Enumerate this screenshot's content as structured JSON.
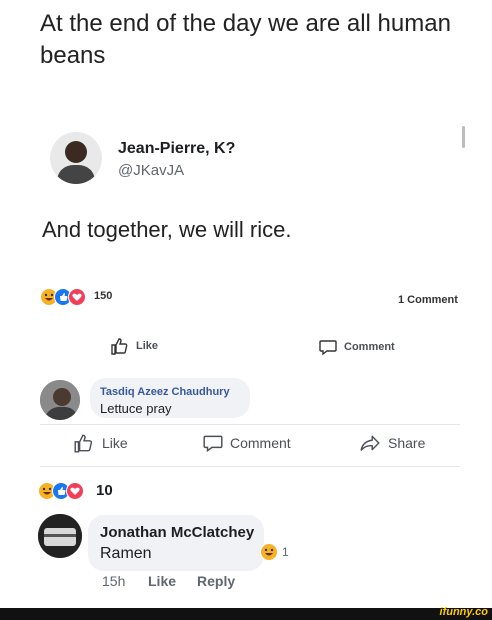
{
  "original_post": {
    "text": "At the end of the day we are all human beans"
  },
  "embedded_tweet": {
    "name": "Jean-Pierre, K?",
    "handle": "@JKavJA",
    "text": "And together, we will rice."
  },
  "embedded_post_stats": {
    "reaction_count": "150",
    "comment_count_label": "1 Comment",
    "like_label": "Like",
    "comment_label": "Comment"
  },
  "embedded_comment": {
    "author": "Tasdiq Azeez Chaudhury",
    "text": "Lettuce pray"
  },
  "actions": {
    "like": "Like",
    "comment": "Comment",
    "share": "Share"
  },
  "post_stats": {
    "reaction_count": "10"
  },
  "comment": {
    "author": "Jonathan McClatchey",
    "text": "Ramen",
    "reaction_count": "1",
    "time": "15h",
    "like": "Like",
    "reply": "Reply"
  },
  "watermark": "ifunny.co",
  "colors": {
    "like_blue": "#1877f2",
    "love_red": "#f33e58",
    "haha_yellow": "#f7b125"
  }
}
